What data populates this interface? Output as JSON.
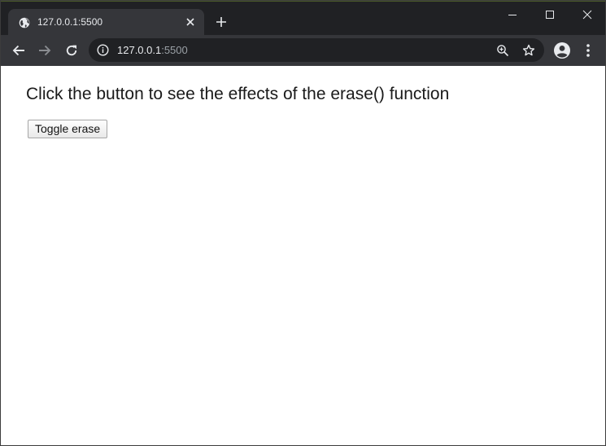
{
  "browser": {
    "tab": {
      "title": "127.0.0.1:5500",
      "favicon": "globe-icon"
    },
    "address_bar": {
      "host": "127.0.0.1",
      "port": ":5500"
    },
    "icons": {
      "back": "back-arrow-icon",
      "forward": "forward-arrow-icon",
      "reload": "reload-icon",
      "info": "info-icon",
      "zoom": "zoom-icon",
      "bookmark": "star-icon",
      "profile": "profile-icon",
      "menu": "more-vert-icon"
    }
  },
  "page": {
    "heading": "Click the button to see the effects of the erase() function",
    "toggle_button_label": "Toggle erase"
  },
  "colors": {
    "titlebar": "#202124",
    "toolbar": "#35363a",
    "omnibox": "#202124",
    "page_background": "#ffffff"
  }
}
